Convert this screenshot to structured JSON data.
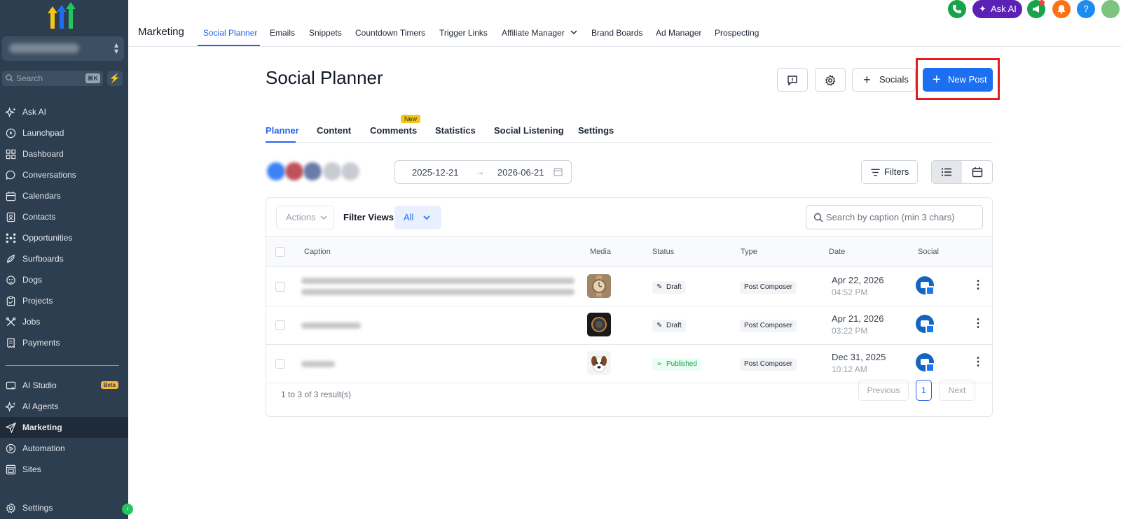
{
  "sidebar": {
    "search_placeholder": "Search",
    "search_shortcut": "⌘K",
    "items": [
      {
        "label": "Ask AI"
      },
      {
        "label": "Launchpad"
      },
      {
        "label": "Dashboard"
      },
      {
        "label": "Conversations"
      },
      {
        "label": "Calendars"
      },
      {
        "label": "Contacts"
      },
      {
        "label": "Opportunities"
      },
      {
        "label": "Surfboards"
      },
      {
        "label": "Dogs"
      },
      {
        "label": "Projects"
      },
      {
        "label": "Jobs"
      },
      {
        "label": "Payments"
      }
    ],
    "lower_items": [
      {
        "label": "AI Studio",
        "badge": "Beta"
      },
      {
        "label": "AI Agents"
      },
      {
        "label": "Marketing"
      },
      {
        "label": "Automation"
      },
      {
        "label": "Sites"
      }
    ],
    "settings_label": "Settings"
  },
  "topnav": {
    "section_title": "Marketing",
    "tabs": [
      {
        "label": "Social Planner"
      },
      {
        "label": "Emails"
      },
      {
        "label": "Snippets"
      },
      {
        "label": "Countdown Timers"
      },
      {
        "label": "Trigger Links"
      },
      {
        "label": "Affiliate Manager"
      },
      {
        "label": "Brand Boards"
      },
      {
        "label": "Ad Manager"
      },
      {
        "label": "Prospecting"
      }
    ],
    "ask_ai_label": "Ask AI",
    "help_label": "?"
  },
  "page": {
    "title": "Social Planner",
    "socials_label": "Socials",
    "new_post_label": "New Post",
    "tabs": [
      {
        "label": "Planner"
      },
      {
        "label": "Content"
      },
      {
        "label": "Comments",
        "badge": "New"
      },
      {
        "label": "Statistics"
      },
      {
        "label": "Social Listening"
      },
      {
        "label": "Settings"
      }
    ],
    "date_from": "2025-12-21",
    "date_to": "2026-06-21",
    "filters_label": "Filters"
  },
  "table": {
    "actions_label": "Actions",
    "filter_views_label": "Filter Views:",
    "filter_view_value": "All",
    "search_placeholder": "Search by caption (min 3 chars)",
    "columns": [
      "Caption",
      "Media",
      "Status",
      "Type",
      "Date",
      "Social"
    ],
    "rows": [
      {
        "status": "Draft",
        "type": "Post Composer",
        "date": "Apr 22, 2026",
        "time": "04:52 PM"
      },
      {
        "status": "Draft",
        "type": "Post Composer",
        "date": "Apr 21, 2026",
        "time": "03:22 PM"
      },
      {
        "status": "Published",
        "type": "Post Composer",
        "date": "Dec 31, 2025",
        "time": "10:12 AM"
      }
    ],
    "results_text": "1 to 3 of 3 result(s)",
    "pagination": {
      "previous": "Previous",
      "current": "1",
      "next": "Next"
    }
  },
  "colors": {
    "sidebar_bg": "#2d3e50",
    "accent": "#1d6ff2",
    "highlight": "#e11d1d",
    "published": "#16a34a"
  }
}
